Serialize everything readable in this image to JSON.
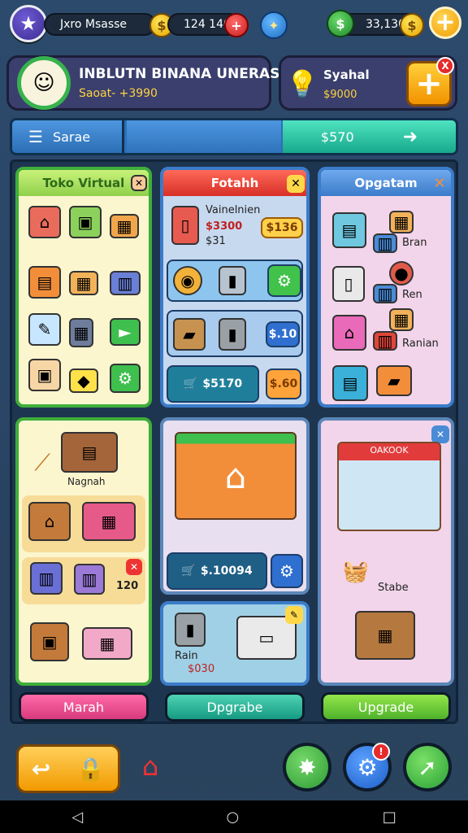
{
  "topbar": {
    "star_icon": "star-icon",
    "left_pill_text": "Jxro Msasse",
    "gold_value": "124 140",
    "right_value": "33,130"
  },
  "profile": {
    "title": "INBLUTN BINANA UNERAS",
    "subtitle": "Saoat- +3990"
  },
  "shop_card": {
    "title": "Syahal",
    "value": "$9000",
    "badge": "X"
  },
  "search": {
    "label": "Sarae",
    "price": "$570"
  },
  "panels": {
    "p1_title": "Toko Virtual",
    "p2_title": "Fotahh",
    "p2_item_name": "Vainelnien",
    "p2_item_price": "$3300",
    "p2_item_sub": "$31",
    "p2_chip": "$136",
    "p2_row2_value": "$.10",
    "p2_row3_price": "$5170",
    "p2_row3_value": "$.60",
    "p3_title": "Opgatam",
    "p3_label1": "Bran",
    "p3_label2": "Ren",
    "p3_label3": "Ranian",
    "p4_label": "Nagnah",
    "p4_badge_value": "120",
    "p5_price": "$.10094",
    "p6_label1": "Rain",
    "p6_label2": "$030",
    "p7_sign": "OAKOOK",
    "p7_label": "Stabe"
  },
  "buttons": {
    "b1": "Marah",
    "b2": "Dpgrabe",
    "b3": "Upgrade"
  },
  "colors": {
    "green": "#3fae3a",
    "blue": "#3b7bc9",
    "gold": "#f29a00",
    "pink_btn": "#e03f86",
    "teal_btn": "#1fb59a",
    "lime_btn": "#58c22e"
  }
}
